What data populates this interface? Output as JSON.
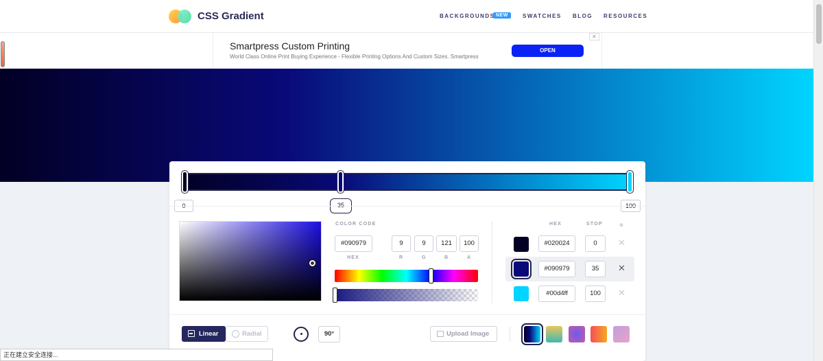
{
  "header": {
    "logo_text": "CSS Gradient",
    "nav": [
      {
        "label": "BACKGROUNDS"
      },
      {
        "label": "SWATCHES"
      },
      {
        "label": "BLOG"
      },
      {
        "label": "RESOURCES"
      }
    ],
    "new_badge": "NEW"
  },
  "ad": {
    "title": "Smartpress Custom Printing",
    "description": "World Class Online Print Buying Experience - Flexible Printing Options And Custom Sizes. Smartpress",
    "button": "OPEN",
    "close": "✕"
  },
  "gradient": {
    "colors": [
      "#020024",
      "#090979",
      "#00d4ff"
    ],
    "stops": [
      0,
      35,
      100
    ],
    "active_stop": 35
  },
  "editor": {
    "color_code_label": "COLOR CODE",
    "hex_value": "#090979",
    "rgba": {
      "r": "9",
      "g": "9",
      "b": "121",
      "a": "100"
    },
    "hex_caption": "HEX",
    "r_caption": "R",
    "g_caption": "G",
    "b_caption": "B",
    "a_caption": "A",
    "hue_position": 0.67,
    "alpha_position": 0.0
  },
  "stops_table": {
    "hex_header": "HEX",
    "stop_header": "STOP",
    "rows": [
      {
        "hex": "#020024",
        "stop": "0",
        "active": false
      },
      {
        "hex": "#090979",
        "stop": "35",
        "active": true
      },
      {
        "hex": "#00d4ff",
        "stop": "100",
        "active": false
      }
    ]
  },
  "toolbar": {
    "linear": "Linear",
    "radial": "Radial",
    "angle": "90°",
    "upload": "Upload Image",
    "presets": [
      "linear-gradient(90deg,#020024,#090979 35%,#00d4ff)",
      "linear-gradient(180deg,#e8c75c,#3fb8b2)",
      "radial-gradient(circle,#6a5cf0,#c45aa6)",
      "linear-gradient(90deg,#f64f59,#f6a623)",
      "linear-gradient(135deg,#c0a0dc,#e9a2c8)"
    ]
  },
  "status_bar": "正在建立安全连接..."
}
